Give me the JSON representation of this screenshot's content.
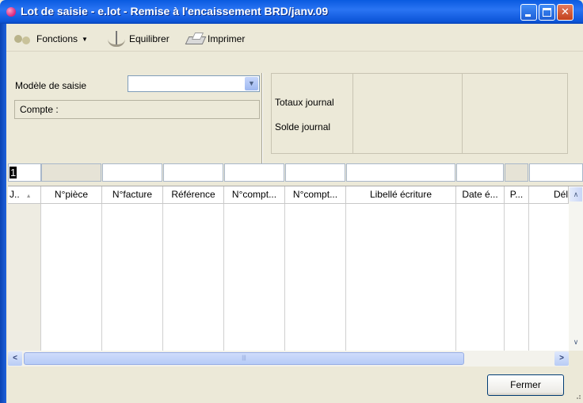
{
  "window": {
    "title": "Lot de saisie - e.lot - Remise à l'encaissement BRD/janv.09",
    "controls": {
      "minimize": "minimize",
      "maximize": "maximize",
      "close": "close"
    }
  },
  "toolbar": {
    "fonctions_label": "Fonctions",
    "equilibrer_label": "Equilibrer",
    "imprimer_label": "Imprimer"
  },
  "form": {
    "modele_label": "Modèle de saisie",
    "modele_value": "",
    "compte_label": "Compte :"
  },
  "totals": {
    "totaux_label": "Totaux journal",
    "solde_label": "Solde journal"
  },
  "entry_row": {
    "first_cell_value": "1"
  },
  "grid": {
    "columns": [
      "J..",
      "N°pièce",
      "N°facture",
      "Référence",
      "N°compt...",
      "N°compt...",
      "Libellé écriture",
      "Date é...",
      "P...",
      "Dél"
    ]
  },
  "scrollbar": {
    "thumb_glyph": "|||"
  },
  "footer": {
    "fermer_label": "Fermer"
  },
  "colors": {
    "titlebar": "#0a5be0",
    "window_bg": "#ece9d8",
    "close_button": "#c3411c"
  }
}
